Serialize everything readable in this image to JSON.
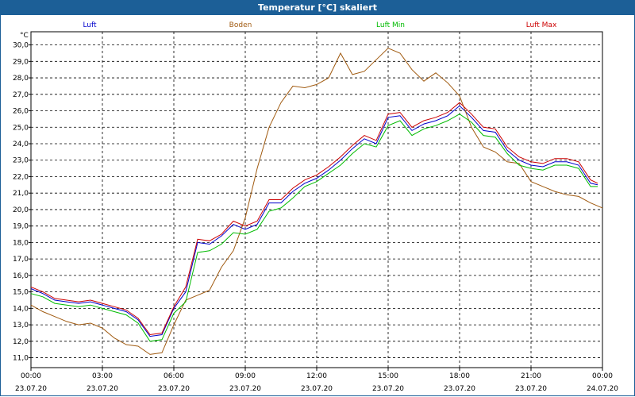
{
  "window": {
    "title": "Temperatur [°C] skaliert"
  },
  "chart_data": {
    "type": "line",
    "title": "Temperatur [°C] skaliert",
    "ylabel": "°C",
    "ylim": [
      10.4,
      30.8
    ],
    "xlim_hours": [
      0,
      24
    ],
    "yticks": [
      "11,0",
      "12,0",
      "13,0",
      "14,0",
      "15,0",
      "16,0",
      "17,0",
      "18,0",
      "19,0",
      "20,0",
      "21,0",
      "22,0",
      "23,0",
      "24,0",
      "25,0",
      "26,0",
      "27,0",
      "28,0",
      "29,0",
      "30,0"
    ],
    "xticks": [
      {
        "time": "00:00",
        "date": "23.07.20"
      },
      {
        "time": "03:00",
        "date": "23.07.20"
      },
      {
        "time": "06:00",
        "date": "23.07.20"
      },
      {
        "time": "09:00",
        "date": "23.07.20"
      },
      {
        "time": "12:00",
        "date": "23.07.20"
      },
      {
        "time": "15:00",
        "date": "23.07.20"
      },
      {
        "time": "18:00",
        "date": "23.07.20"
      },
      {
        "time": "21:00",
        "date": "23.07.20"
      },
      {
        "time": "00:00",
        "date": "24.07.20"
      }
    ],
    "grid": true,
    "legend_position": "top",
    "series": [
      {
        "name": "Luft",
        "color": "#0000cc",
        "x": [
          0,
          0.5,
          1,
          1.5,
          2,
          2.5,
          3,
          3.5,
          4,
          4.5,
          5,
          5.5,
          6,
          6.5,
          7,
          7.5,
          8,
          8.5,
          9,
          9.5,
          10,
          10.5,
          11,
          11.5,
          12,
          12.5,
          13,
          13.5,
          14,
          14.5,
          15,
          15.5,
          16,
          16.5,
          17,
          17.5,
          18,
          18.5,
          19,
          19.5,
          20,
          20.5,
          21,
          21.5,
          22,
          22.5,
          23,
          23.5,
          23.8
        ],
        "y": [
          15.2,
          14.9,
          14.5,
          14.4,
          14.3,
          14.4,
          14.2,
          14.0,
          13.8,
          13.3,
          12.3,
          12.4,
          14.0,
          15.0,
          18.0,
          17.9,
          18.4,
          19.1,
          18.8,
          19.1,
          20.4,
          20.4,
          21.1,
          21.6,
          21.9,
          22.4,
          23.0,
          23.7,
          24.3,
          24.0,
          25.6,
          25.7,
          24.8,
          25.2,
          25.4,
          25.7,
          26.3,
          25.6,
          24.8,
          24.7,
          23.6,
          23.0,
          22.7,
          22.6,
          22.9,
          22.9,
          22.7,
          21.6,
          21.5
        ]
      },
      {
        "name": "Boden",
        "color": "#a05a10",
        "x": [
          0,
          0.5,
          1,
          1.5,
          2,
          2.5,
          3,
          3.5,
          4,
          4.5,
          5,
          5.5,
          6,
          6.5,
          7,
          7.5,
          8,
          8.5,
          9,
          9.5,
          10,
          10.5,
          11,
          11.5,
          12,
          12.5,
          13,
          13.5,
          14,
          14.5,
          15,
          15.5,
          16,
          16.5,
          17,
          17.5,
          18,
          18.5,
          19,
          19.5,
          20,
          20.5,
          21,
          21.5,
          22,
          22.5,
          23,
          23.5,
          24
        ],
        "y": [
          14.2,
          13.8,
          13.5,
          13.2,
          13.0,
          13.1,
          12.8,
          12.2,
          11.8,
          11.7,
          11.2,
          11.3,
          13.0,
          14.5,
          14.8,
          15.1,
          16.5,
          17.5,
          19.5,
          22.5,
          25.0,
          26.5,
          27.5,
          27.4,
          27.6,
          28.0,
          29.5,
          28.2,
          28.4,
          29.1,
          29.8,
          29.5,
          28.5,
          27.8,
          28.3,
          27.7,
          26.9,
          25.0,
          23.8,
          23.5,
          22.9,
          22.8,
          21.7,
          21.4,
          21.1,
          20.9,
          20.8,
          20.4,
          20.1
        ]
      },
      {
        "name": "Luft Min",
        "color": "#00bb00",
        "x": [
          0,
          0.5,
          1,
          1.5,
          2,
          2.5,
          3,
          3.5,
          4,
          4.5,
          5,
          5.5,
          6,
          6.5,
          7,
          7.5,
          8,
          8.5,
          9,
          9.5,
          10,
          10.5,
          11,
          11.5,
          12,
          12.5,
          13,
          13.5,
          14,
          14.5,
          15,
          15.5,
          16,
          16.5,
          17,
          17.5,
          18,
          18.5,
          19,
          19.5,
          20,
          20.5,
          21,
          21.5,
          22,
          22.5,
          23,
          23.5,
          23.8
        ],
        "y": [
          14.9,
          14.7,
          14.3,
          14.2,
          14.1,
          14.2,
          14.0,
          13.8,
          13.6,
          13.1,
          12.0,
          12.1,
          13.7,
          14.4,
          17.4,
          17.5,
          17.9,
          18.6,
          18.5,
          18.8,
          19.9,
          20.1,
          20.7,
          21.4,
          21.7,
          22.2,
          22.7,
          23.4,
          24.0,
          23.8,
          25.1,
          25.4,
          24.5,
          24.9,
          25.1,
          25.4,
          25.8,
          25.3,
          24.5,
          24.4,
          23.4,
          22.7,
          22.5,
          22.4,
          22.7,
          22.7,
          22.5,
          21.4,
          21.4
        ]
      },
      {
        "name": "Luft Max",
        "color": "#cc0000",
        "x": [
          0,
          0.5,
          1,
          1.5,
          2,
          2.5,
          3,
          3.5,
          4,
          4.5,
          5,
          5.5,
          6,
          6.5,
          7,
          7.5,
          8,
          8.5,
          9,
          9.5,
          10,
          10.5,
          11,
          11.5,
          12,
          12.5,
          13,
          13.5,
          14,
          14.5,
          15,
          15.5,
          16,
          16.5,
          17,
          17.5,
          18,
          18.5,
          19,
          19.5,
          20,
          20.5,
          21,
          21.5,
          22,
          22.5,
          23,
          23.5,
          23.8
        ],
        "y": [
          15.3,
          15.0,
          14.6,
          14.5,
          14.4,
          14.5,
          14.3,
          14.1,
          13.9,
          13.4,
          12.4,
          12.5,
          14.1,
          15.3,
          18.2,
          18.1,
          18.5,
          19.3,
          19.0,
          19.3,
          20.6,
          20.6,
          21.3,
          21.8,
          22.1,
          22.6,
          23.2,
          23.9,
          24.5,
          24.2,
          25.8,
          25.9,
          25.0,
          25.4,
          25.6,
          25.9,
          26.5,
          25.8,
          25.0,
          24.9,
          23.8,
          23.2,
          22.9,
          22.8,
          23.1,
          23.1,
          22.9,
          21.8,
          21.6
        ]
      }
    ]
  }
}
